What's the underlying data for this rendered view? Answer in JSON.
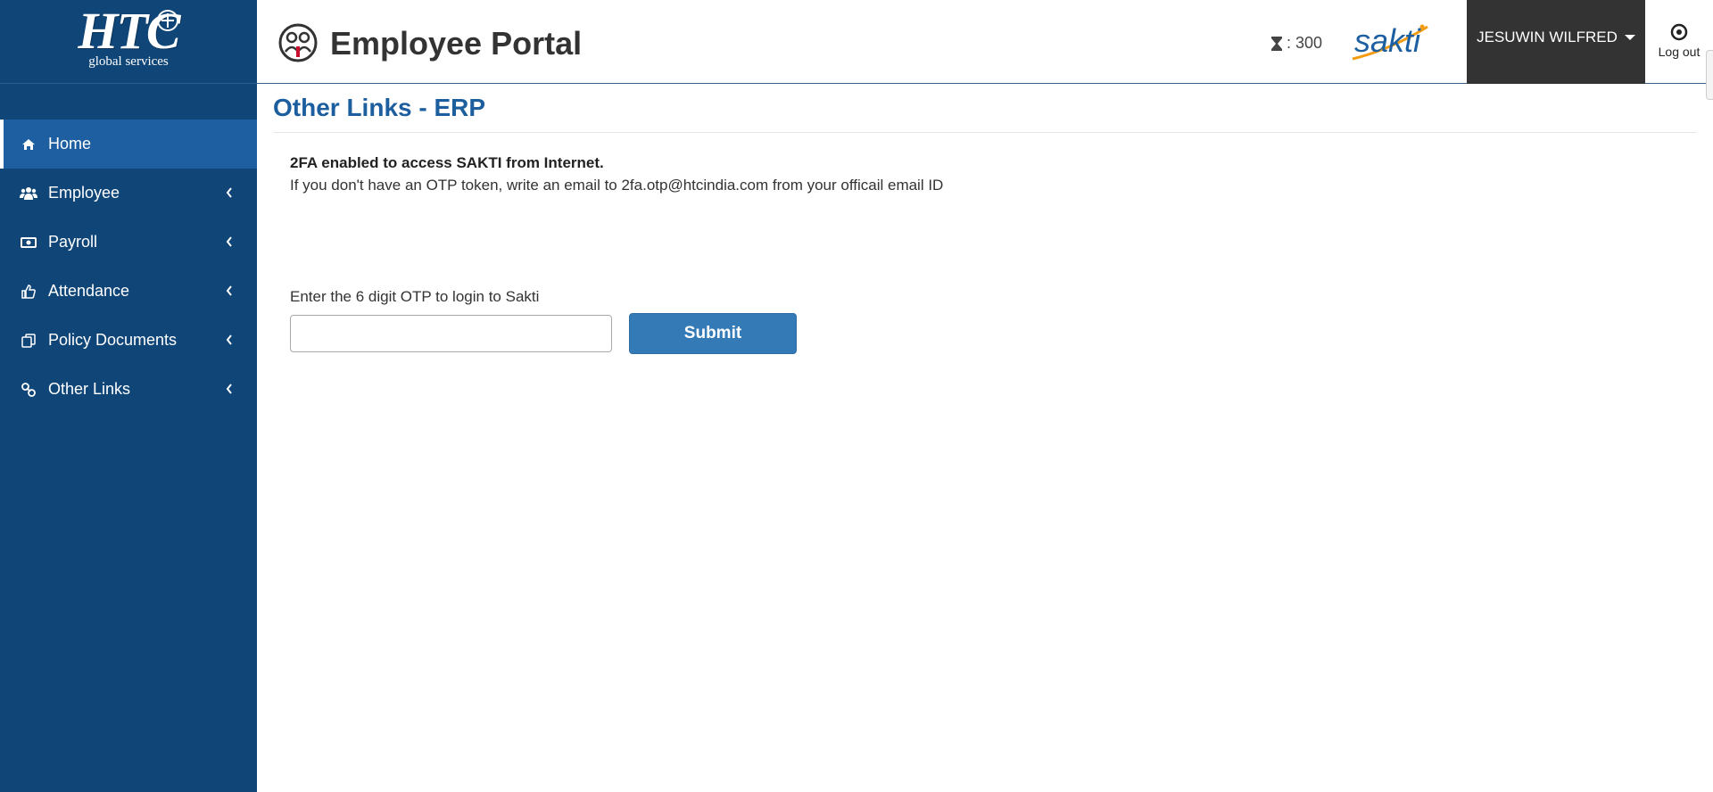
{
  "brand": {
    "logo_text": "HTC",
    "logo_subtext": "global services",
    "portal_title": "Employee Portal",
    "sakti_logo_text": "sakti"
  },
  "sidebar": {
    "items": [
      {
        "label": "Home",
        "icon": "home-icon",
        "active": true
      },
      {
        "label": "Employee",
        "icon": "users-icon",
        "active": false
      },
      {
        "label": "Payroll",
        "icon": "money-icon",
        "active": false
      },
      {
        "label": "Attendance",
        "icon": "thumbs-up-icon",
        "active": false
      },
      {
        "label": "Policy Documents",
        "icon": "documents-icon",
        "active": false
      },
      {
        "label": "Other Links",
        "icon": "link-icon",
        "active": false
      }
    ]
  },
  "header": {
    "timer_value": ": 300",
    "user_name": "JESUWIN WILFRED",
    "logout_label": "Log out"
  },
  "main": {
    "page_title": "Other Links - ERP",
    "notice_bold": "2FA enabled to access SAKTI from Internet.",
    "notice_text": "If you don't have an OTP token, write an email to 2fa.otp@htcindia.com from your officail email ID",
    "otp_label": "Enter the 6 digit OTP to login to Sakti",
    "otp_value": "",
    "submit_label": "Submit"
  },
  "colors": {
    "sidebar_bg": "#0f4577",
    "sidebar_active": "#1d5fa0",
    "accent": "#1d5e9e",
    "button": "#347ab7",
    "user_menu_bg": "#333333"
  }
}
